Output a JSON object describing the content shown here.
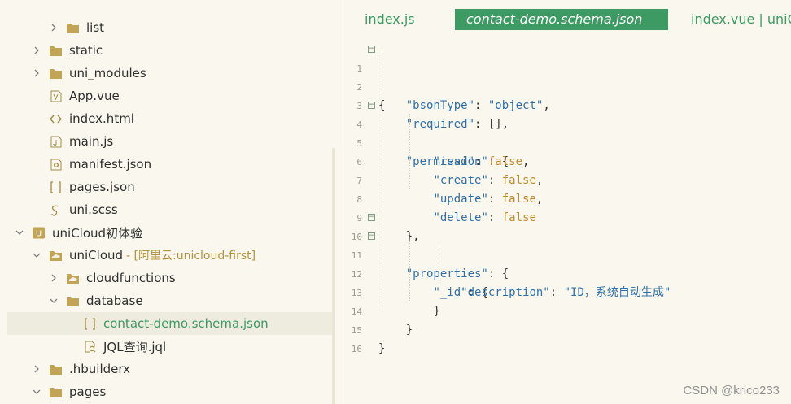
{
  "explorer": {
    "items": [
      {
        "label": "list",
        "kind": "folder",
        "expanded": false
      },
      {
        "label": "static",
        "kind": "folder",
        "expanded": false
      },
      {
        "label": "uni_modules",
        "kind": "folder",
        "expanded": false
      },
      {
        "label": "App.vue",
        "kind": "vue-file"
      },
      {
        "label": "index.html",
        "kind": "html-file"
      },
      {
        "label": "main.js",
        "kind": "js-file"
      },
      {
        "label": "manifest.json",
        "kind": "manifest-file"
      },
      {
        "label": "pages.json",
        "kind": "json-file"
      },
      {
        "label": "uni.scss",
        "kind": "scss-file"
      },
      {
        "label": "uniCloud初体验",
        "kind": "project",
        "expanded": true
      },
      {
        "label": "uniCloud",
        "kind": "cloud-folder",
        "expanded": true,
        "suffix": "- [阿里云:unicloud-first]"
      },
      {
        "label": "cloudfunctions",
        "kind": "cloud-folder",
        "expanded": false
      },
      {
        "label": "database",
        "kind": "folder",
        "expanded": true
      },
      {
        "label": "contact-demo.schema.json",
        "kind": "json-file",
        "selected": true
      },
      {
        "label": "JQL查询.jql",
        "kind": "jql-file"
      },
      {
        "label": ".hbuilderx",
        "kind": "folder",
        "expanded": false
      },
      {
        "label": "pages",
        "kind": "folder",
        "expanded": true
      }
    ]
  },
  "tabs": [
    {
      "label": "index.js",
      "active": false
    },
    {
      "label": "contact-demo.schema.json",
      "active": true
    },
    {
      "label": "index.vue | uniC",
      "active": false
    }
  ],
  "code": {
    "line_numbers": [
      "1",
      "2",
      "3",
      "4",
      "5",
      "6",
      "7",
      "8",
      "9",
      "10",
      "11",
      "12",
      "13",
      "14",
      "15",
      "16"
    ]
  },
  "watermark": "CSDN @krico233",
  "colors": {
    "accent": "#3c9a62",
    "background": "#faf8ee"
  }
}
